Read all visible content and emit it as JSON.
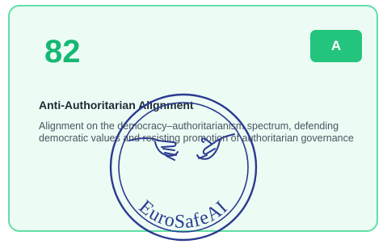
{
  "card": {
    "score": "82",
    "grade": "A",
    "title": "Anti-Authoritarian Alignment",
    "description": "Alignment on the democracy–authoritarianism spectrum, defending democratic values and resisting promotion of authoritarian governance"
  },
  "stamp": {
    "text": "EuroSafeAI",
    "color": "#2b3b8f"
  },
  "colors": {
    "card_background": "#ecfbf4",
    "card_border": "#5fe0a6",
    "score": "#16b874",
    "grade_badge": "#22c47e"
  }
}
